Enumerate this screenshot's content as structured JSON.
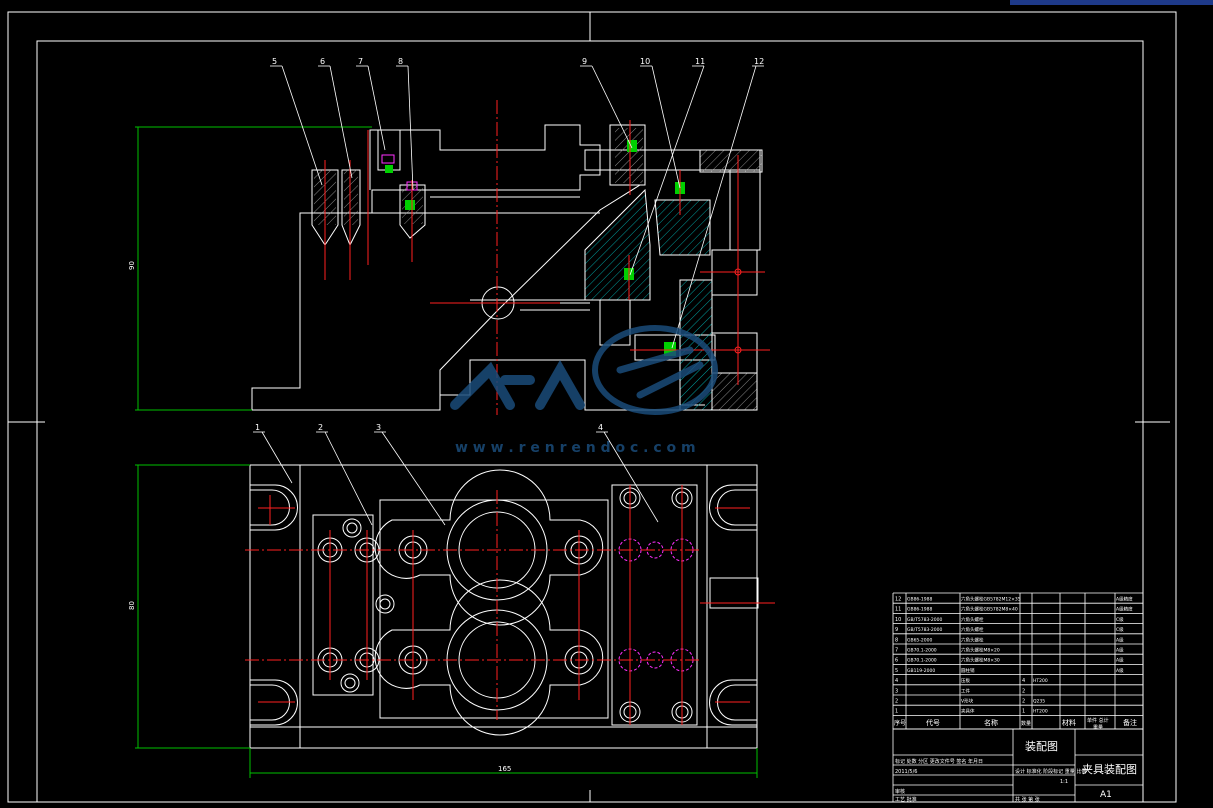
{
  "drawing": {
    "callouts_top": [
      "5",
      "6",
      "7",
      "8",
      "9",
      "10",
      "11",
      "12"
    ],
    "callouts_bottom": [
      "1",
      "2",
      "3",
      "4"
    ],
    "dimensions": {
      "top_view_height": "90",
      "bottom_view_height": "80",
      "bottom_view_width": "165"
    },
    "watermark_url": "w w w . r e n r e n d o c . c o m"
  },
  "bom": {
    "rows": [
      {
        "idx": "12",
        "code": "GB86-1988",
        "name": "六角头螺栓GB5782M12×35",
        "qty": "",
        "material": "",
        "note": "A级精度"
      },
      {
        "idx": "11",
        "code": "GB86-1988",
        "name": "六角头螺栓GB5782M8×40",
        "qty": "",
        "material": "",
        "note": "A级精度"
      },
      {
        "idx": "10",
        "code": "GB/T5783-2000",
        "name": "六角头螺栓",
        "qty": "",
        "material": "",
        "note": "C级"
      },
      {
        "idx": "9",
        "code": "GB/T5783-2000",
        "name": "六角头螺栓",
        "qty": "",
        "material": "",
        "note": "C级"
      },
      {
        "idx": "8",
        "code": "GB65-2000",
        "name": "六角头螺栓",
        "qty": "",
        "material": "",
        "note": "A级"
      },
      {
        "idx": "7",
        "code": "GB70.1-2000",
        "name": "六角头螺栓M8×20",
        "qty": "",
        "material": "",
        "note": "A级"
      },
      {
        "idx": "6",
        "code": "GB70.1-2000",
        "name": "六角头螺栓M8×30",
        "qty": "",
        "material": "",
        "note": "A级"
      },
      {
        "idx": "5",
        "code": "GB119-2000",
        "name": "圆柱销",
        "qty": "",
        "material": "",
        "note": "A级"
      },
      {
        "idx": "4",
        "code": "",
        "name": "压板",
        "qty": "4",
        "material": "HT200",
        "note": ""
      },
      {
        "idx": "3",
        "code": "",
        "name": "工件",
        "qty": "2",
        "material": "",
        "note": ""
      },
      {
        "idx": "2",
        "code": "",
        "name": "V形块",
        "qty": "2",
        "material": "Q235",
        "note": ""
      },
      {
        "idx": "1",
        "code": "",
        "name": "夹具体",
        "qty": "1",
        "material": "HT200",
        "note": ""
      }
    ],
    "header": {
      "idx": "序号",
      "code": "代号",
      "name": "名称",
      "qty": "数量",
      "material": "材料",
      "weight": "单件 总计",
      "weight_sub": "重量",
      "note": "备注"
    }
  },
  "title_block": {
    "drawing_type": "装配图",
    "title": "夹具装配图",
    "sheet_size": "A1",
    "scale": "1:1",
    "row1": "标记 处数 分区 更改文件号 签名 年月日",
    "row2": "设计 标准化 阶段标记 重量 比例",
    "row3": "审核",
    "row4": "工艺 批准",
    "stage_labels": "共 张 第 张",
    "date_label": "2011/5/6"
  },
  "colors": {
    "bg": "#000000",
    "line": "#ffffff",
    "center": "#ff2020",
    "dim": "#00c000",
    "hatch": "#00a0a0",
    "magenta": "#ff30ff",
    "blue_watermark": "#1a4c7a"
  }
}
